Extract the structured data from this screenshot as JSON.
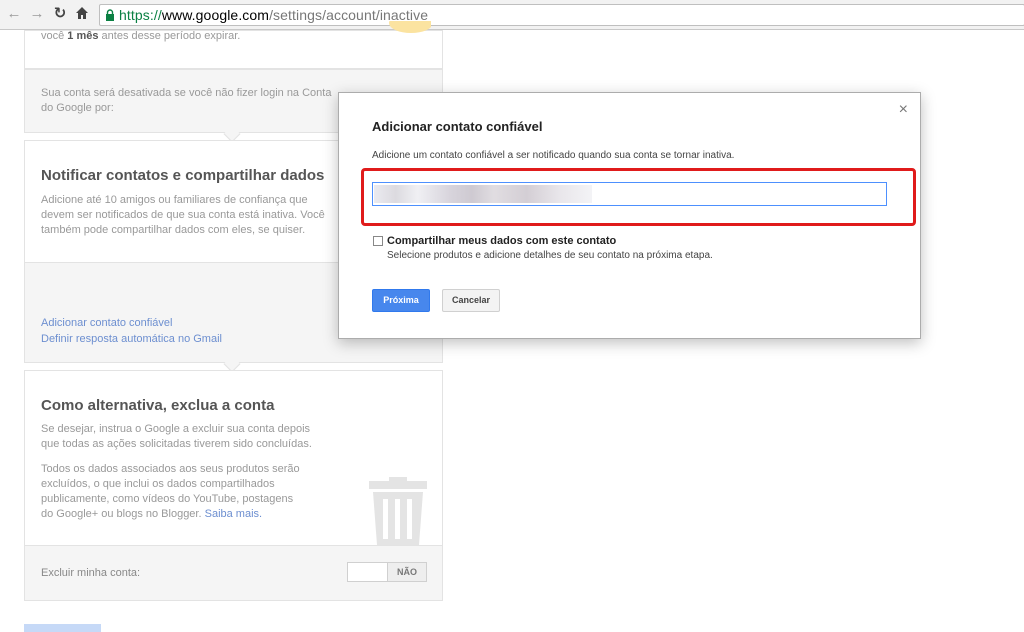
{
  "browser": {
    "url_scheme": "https://",
    "url_host": "www.google.com",
    "url_path": "/settings/account/inactive"
  },
  "page": {
    "top_card": {
      "text_pre": "você ",
      "text_bold": "1 mês",
      "text_post": " antes desse período expirar."
    },
    "deactivate_card": {
      "text": "Sua conta será desativada se você não fizer login na Conta do Google por:"
    },
    "notify_card": {
      "heading": "Notificar contatos e compartilhar dados",
      "desc": "Adicione até 10 amigos ou familiares de confiança que devem ser notificados de que sua conta está inativa. Você também pode compartilhar dados com eles, se quiser.",
      "link_add": "Adicionar contato confiável",
      "link_reply": "Definir resposta automática no Gmail"
    },
    "delete_card": {
      "heading": "Como alternativa, exclua a conta",
      "desc1": "Se desejar, instrua o Google a excluir sua conta depois que todas as ações solicitadas tiverem sido concluídas.",
      "desc2": "Todos os dados associados aos seus produtos serão excluídos, o que inclui os dados compartilhados publicamente, como vídeos do YouTube, postagens do Google+ ou blogs no Blogger.",
      "learn_more": "Saiba mais.",
      "row_label": "Excluir minha conta:",
      "toggle_value": "NÃO"
    }
  },
  "dialog": {
    "title": "Adicionar contato confiável",
    "description": "Adicione um contato confiável a ser notificado quando sua conta se tornar inativa.",
    "checkbox_label": "Compartilhar meus dados com este contato",
    "checkbox_help": "Selecione produtos e adicione detalhes de seu contato na próxima etapa.",
    "primary_button": "Próxima",
    "secondary_button": "Cancelar",
    "close_symbol": "×",
    "highlight_color": "#e01b1b"
  },
  "colors": {
    "accent": "#4787ed",
    "link": "#6d8fd0",
    "secure": "#0b8043"
  }
}
